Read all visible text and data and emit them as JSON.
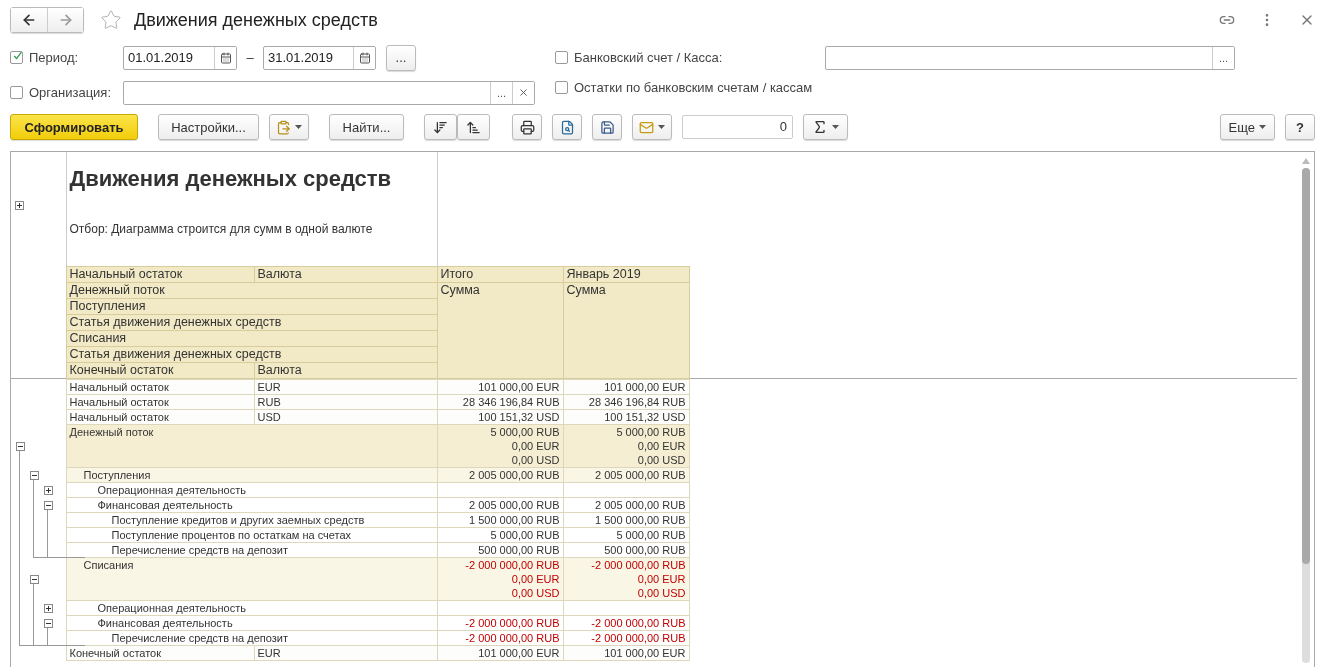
{
  "window": {
    "title": "Движения денежных средств"
  },
  "filters": {
    "period": {
      "label": "Период:",
      "checked": true,
      "from": "01.01.2019",
      "separator": "–",
      "to": "31.01.2019",
      "select_button": "..."
    },
    "organization": {
      "label": "Организация:",
      "checked": false,
      "choose_button": "..."
    },
    "bank_account": {
      "label": "Банковский счет / Касса:",
      "checked": false,
      "choose_button": "..."
    },
    "balances": {
      "label": "Остатки по банковским счетам / кассам",
      "checked": false
    }
  },
  "toolbar": {
    "generate": "Сформировать",
    "settings": "Настройки...",
    "find": "Найти...",
    "counter": "0",
    "more": "Еще",
    "help": "?"
  },
  "report": {
    "title": "Движения денежных средств",
    "filter_note": "Отбор: Диаграмма строится для сумм в одной валюте",
    "header": {
      "expanded": false,
      "periods": [
        {
          "label": "Итого",
          "sub": "Сумма"
        },
        {
          "label": "Январь 2019",
          "sub": "Сумма"
        }
      ],
      "lines": [
        {
          "cells": [
            "Начальный остаток",
            "Валюта"
          ]
        },
        {
          "cells": [
            "Денежный поток"
          ]
        },
        {
          "cells": [
            "Поступления"
          ]
        },
        {
          "cells": [
            "Статья движения денежных средств"
          ]
        },
        {
          "cells": [
            "Списания"
          ]
        },
        {
          "cells": [
            "Статья движения денежных средств"
          ]
        },
        {
          "cells": [
            "Конечный остаток",
            "Валюта"
          ]
        }
      ]
    },
    "rows": [
      {
        "kind": "balance",
        "label": "Начальный остаток",
        "currency": "EUR",
        "total": [
          "101 000,00 EUR"
        ],
        "month": [
          "101 000,00 EUR"
        ]
      },
      {
        "kind": "balance",
        "label": "Начальный остаток",
        "currency": "RUB",
        "total": [
          "28 346 196,84 RUB"
        ],
        "month": [
          "28 346 196,84 RUB"
        ]
      },
      {
        "kind": "balance",
        "label": "Начальный остаток",
        "currency": "USD",
        "total": [
          "100 151,32 USD"
        ],
        "month": [
          "100 151,32 USD"
        ]
      },
      {
        "kind": "group",
        "label": "Денежный поток",
        "expanded": true,
        "negative": false,
        "total": [
          "5 000,00 RUB",
          "0,00 EUR",
          "0,00 USD"
        ],
        "month": [
          "5 000,00 RUB",
          "0,00 EUR",
          "0,00 USD"
        ],
        "children": [
          {
            "kind": "group",
            "label": "Поступления",
            "expanded": true,
            "negative": false,
            "total": [
              "2 005 000,00 RUB"
            ],
            "month": [
              "2 005 000,00 RUB"
            ],
            "children": [
              {
                "kind": "group",
                "label": "Операционная деятельность",
                "expanded": false,
                "negative": false
              },
              {
                "kind": "group",
                "label": "Финансовая деятельность",
                "expanded": true,
                "negative": false,
                "total": [
                  "2 005 000,00 RUB"
                ],
                "month": [
                  "2 005 000,00 RUB"
                ],
                "children": [
                  {
                    "kind": "item",
                    "label": "Поступление кредитов и других заемных средств",
                    "negative": false,
                    "total": [
                      "1 500 000,00 RUB"
                    ],
                    "month": [
                      "1 500 000,00 RUB"
                    ]
                  },
                  {
                    "kind": "item",
                    "label": "Поступление процентов по остаткам на счетах",
                    "negative": false,
                    "total": [
                      "5 000,00 RUB"
                    ],
                    "month": [
                      "5 000,00 RUB"
                    ]
                  },
                  {
                    "kind": "item",
                    "label": "Перечисление средств на депозит",
                    "negative": false,
                    "total": [
                      "500 000,00 RUB"
                    ],
                    "month": [
                      "500 000,00 RUB"
                    ]
                  }
                ]
              }
            ]
          },
          {
            "kind": "group",
            "label": "Списания",
            "expanded": true,
            "negative": true,
            "total": [
              "-2 000 000,00 RUB",
              "0,00 EUR",
              "0,00 USD"
            ],
            "month": [
              "-2 000 000,00 RUB",
              "0,00 EUR",
              "0,00 USD"
            ],
            "children": [
              {
                "kind": "group",
                "label": "Операционная деятельность",
                "expanded": false,
                "negative": false
              },
              {
                "kind": "group",
                "label": "Финансовая деятельность",
                "expanded": true,
                "negative": true,
                "total": [
                  "-2 000 000,00 RUB"
                ],
                "month": [
                  "-2 000 000,00 RUB"
                ],
                "children": [
                  {
                    "kind": "item",
                    "label": "Перечисление средств на депозит",
                    "negative": true,
                    "total": [
                      "-2 000 000,00 RUB"
                    ],
                    "month": [
                      "-2 000 000,00 RUB"
                    ]
                  }
                ]
              }
            ]
          }
        ]
      },
      {
        "kind": "balance",
        "label": "Конечный остаток",
        "currency": "EUR",
        "total": [
          "101 000,00 EUR"
        ],
        "month": [
          "101 000,00 EUR"
        ]
      }
    ]
  }
}
